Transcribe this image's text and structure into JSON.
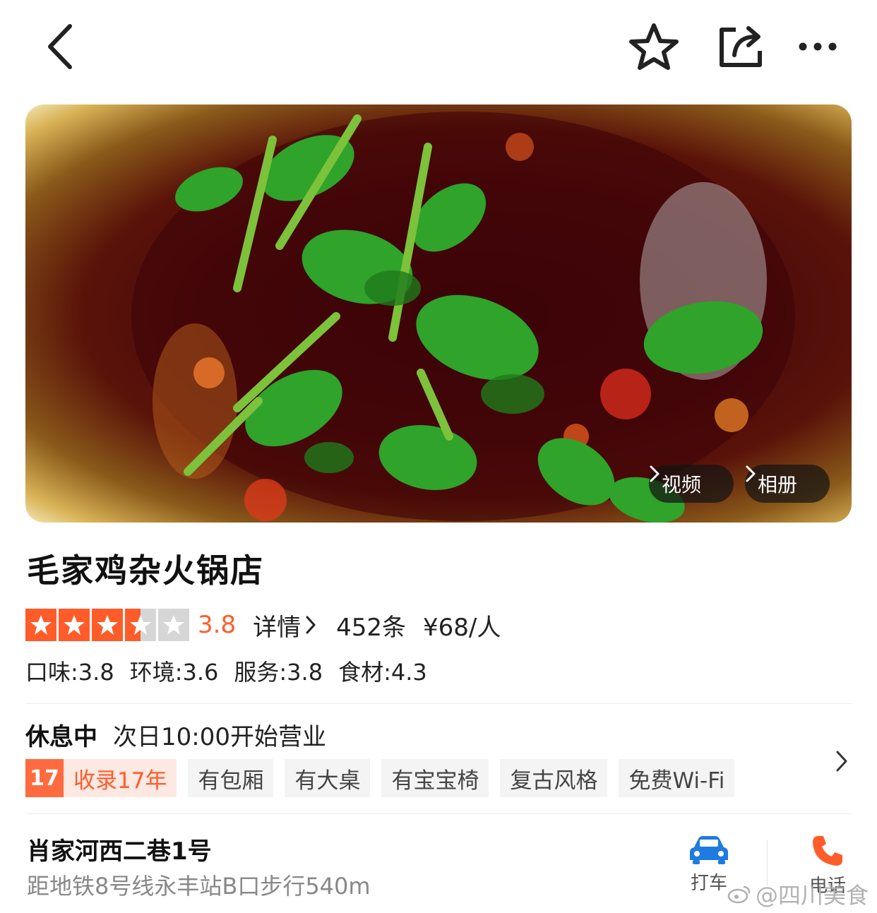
{
  "nav": {
    "back_icon": "back-chevron-icon",
    "favorite_icon": "star-outline-icon",
    "share_icon": "share-icon",
    "more_icon": "more-dots-icon"
  },
  "hero": {
    "video_label": "视频",
    "album_label": "相册"
  },
  "shop": {
    "name": "毛家鸡杂火锅店",
    "rating_stars": 3.5,
    "score": "3.8",
    "detail_label": "详情",
    "reviews": "452条",
    "price": "¥68/人",
    "subscores": {
      "taste": "口味:3.8",
      "environment": "环境:3.6",
      "service": "服务:3.8",
      "ingredients": "食材:4.3"
    }
  },
  "hours": {
    "status": "休息中",
    "next_open": "次日10:00开始营业"
  },
  "tags": {
    "years_badge": "17",
    "years_label": "收录17年",
    "items": [
      "有包厢",
      "有大桌",
      "有宝宝椅",
      "复古风格",
      "免费Wi-Fi"
    ]
  },
  "address": {
    "street": "肖家河西二巷1号",
    "distance": "距地铁8号线永丰站B口步行540m"
  },
  "actions": {
    "taxi_label": "打车",
    "phone_label": "电话"
  },
  "watermark": "@四川美食",
  "colors": {
    "accent": "#ff5c2a",
    "taxi_blue": "#1e7be0"
  }
}
